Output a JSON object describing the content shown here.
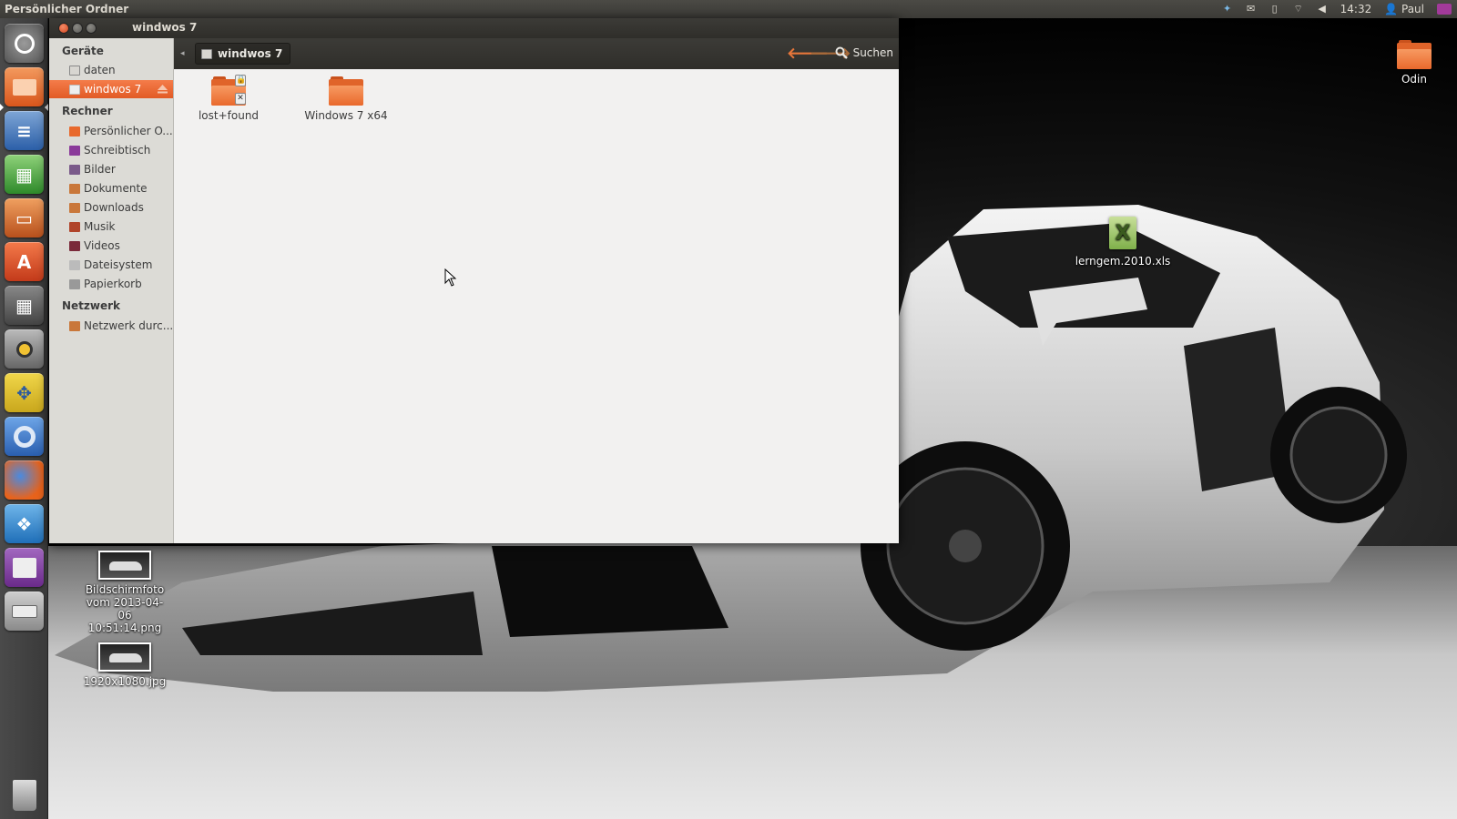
{
  "top_panel": {
    "title": "Persönlicher Ordner",
    "time": "14:32",
    "user": "Paul"
  },
  "launcher": {
    "items": [
      {
        "name": "dash-home",
        "icon": "ubuntu-logo-icon"
      },
      {
        "name": "files",
        "icon": "folder-icon"
      },
      {
        "name": "writer",
        "icon": "libreoffice-writer-icon"
      },
      {
        "name": "calc",
        "icon": "libreoffice-calc-icon"
      },
      {
        "name": "impress",
        "icon": "libreoffice-impress-icon"
      },
      {
        "name": "software-center",
        "icon": "shopping-bag-icon"
      },
      {
        "name": "calculator",
        "icon": "calculator-icon"
      },
      {
        "name": "rhythmbox",
        "icon": "speaker-icon"
      },
      {
        "name": "workspace-switcher",
        "icon": "arrows-icon"
      },
      {
        "name": "chromium",
        "icon": "chromium-icon"
      },
      {
        "name": "firefox",
        "icon": "firefox-icon"
      },
      {
        "name": "dropbox",
        "icon": "dropbox-icon"
      },
      {
        "name": "workspaces",
        "icon": "window-icon"
      },
      {
        "name": "drive",
        "icon": "hard-drive-icon"
      },
      {
        "name": "trash",
        "icon": "trash-icon"
      }
    ]
  },
  "window": {
    "title": "windwos 7",
    "breadcrumb": "windwos 7",
    "search_label": "Suchen"
  },
  "sidebar": {
    "sections": {
      "devices": "Geräte",
      "computer": "Rechner",
      "network": "Netzwerk"
    },
    "devices": [
      "daten",
      "windwos 7"
    ],
    "computer": [
      "Persönlicher O...",
      "Schreibtisch",
      "Bilder",
      "Dokumente",
      "Downloads",
      "Musik",
      "Videos",
      "Dateisystem",
      "Papierkorb"
    ],
    "network": [
      "Netzwerk durc..."
    ]
  },
  "files": [
    {
      "label": "lost+found",
      "icon": "folder-locked-icon"
    },
    {
      "label": "Windows 7 x64",
      "icon": "folder-icon"
    }
  ],
  "desktop": {
    "odin": "Odin",
    "xls": "lerngem.2010.xls",
    "screenshot_line1": "Bildschirmfoto",
    "screenshot_line2": "vom 2013-04-06",
    "screenshot_line3": "10:51:14.png",
    "jpg": "1920x1080.jpg"
  },
  "colors": {
    "accent": "#e25b25",
    "panel": "#3c3b37",
    "sidebar": "#dcdbd6",
    "content": "#f2f1f0"
  }
}
